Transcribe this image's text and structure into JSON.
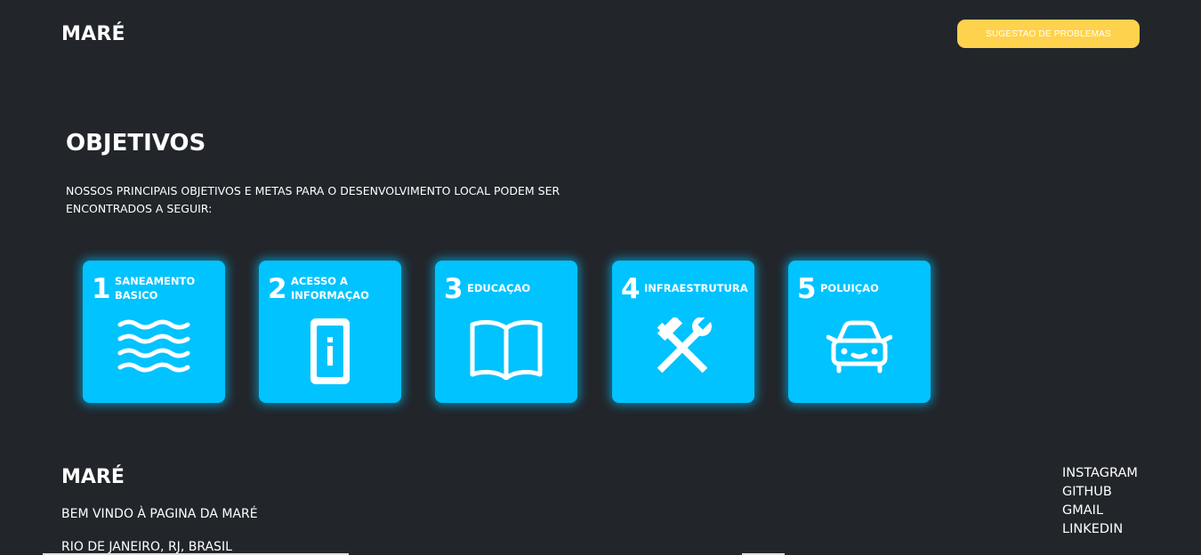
{
  "header": {
    "brand": "MARÉ",
    "suggest_button": "SUGESTAO DE PROBLEMAS"
  },
  "objectives": {
    "title": "OBJETIVOS",
    "description": "NOSSOS PRINCIPAIS OBJETIVOS E METAS PARA O DESENVOLVIMENTO LOCAL PODEM SER ENCONTRADOS A SEGUIR:",
    "cards": [
      {
        "number": "1",
        "label": "SANEAMENTO BASICO",
        "icon": "waves-icon"
      },
      {
        "number": "2",
        "label": "ACESSO A INFORMAÇAO",
        "icon": "phone-info-icon"
      },
      {
        "number": "3",
        "label": "EDUCAÇAO",
        "icon": "book-icon"
      },
      {
        "number": "4",
        "label": "INFRAESTRUTURA",
        "icon": "tools-icon"
      },
      {
        "number": "5",
        "label": "POLUIÇAO",
        "icon": "car-icon"
      }
    ]
  },
  "footer": {
    "brand": "MARÉ",
    "welcome": "BEM VINDO À PAGINA DA MARÉ",
    "location": "RIO DE JANEIRO, RJ, BRASIL",
    "links": [
      "INSTAGRAM",
      "GITHUB",
      "GMAIL",
      "LINKEDIN"
    ]
  },
  "colors": {
    "background": "#22262b",
    "card": "#00c3ff",
    "button": "#ffd24d",
    "text": "#ffffff"
  }
}
